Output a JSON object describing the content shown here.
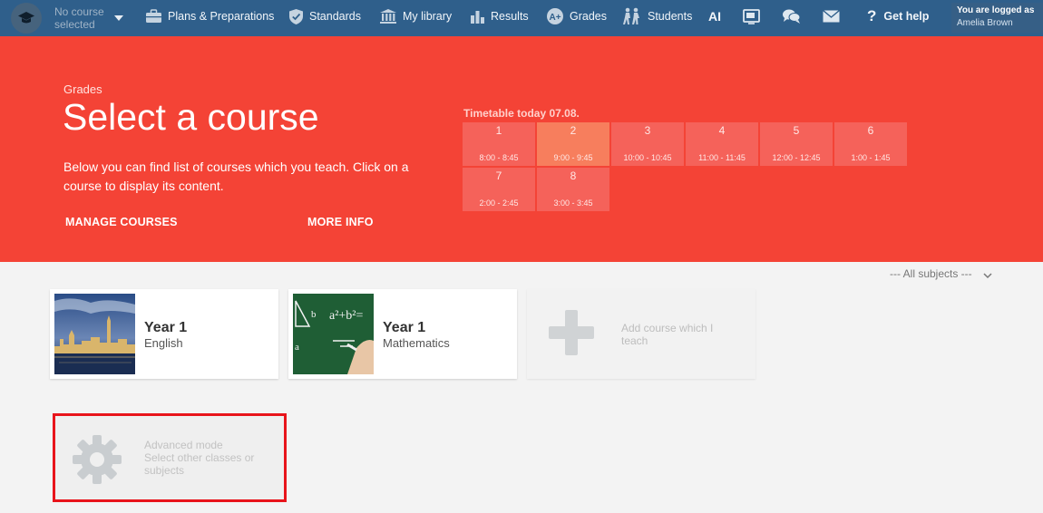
{
  "nav": {
    "course_selector": "No course selected",
    "items": [
      {
        "label": "Plans & Preparations",
        "icon": "briefcase-icon"
      },
      {
        "label": "Standards",
        "icon": "shield-check-icon"
      },
      {
        "label": "My library",
        "icon": "library-icon"
      },
      {
        "label": "Results",
        "icon": "bar-chart-icon"
      },
      {
        "label": "Grades",
        "icon": "grades-icon"
      },
      {
        "label": "Students",
        "icon": "students-icon"
      }
    ],
    "ai_label": "AI",
    "help_label": "Get help",
    "login": {
      "line1": "You are logged as",
      "user": "Amelia Brown"
    }
  },
  "hero": {
    "breadcrumb": "Grades",
    "title": "Select a course",
    "description": "Below you can find list of courses which you teach. Click on a course to display its content.",
    "manage_courses": "MANAGE COURSES",
    "more_info": "MORE INFO",
    "accent_color": "#f44336"
  },
  "timetable": {
    "title": "Timetable today 07.08.",
    "periods": [
      {
        "num": "1",
        "time": "8:00 - 8:45",
        "active": false
      },
      {
        "num": "2",
        "time": "9:00 - 9:45",
        "active": true
      },
      {
        "num": "3",
        "time": "10:00 - 10:45",
        "active": false
      },
      {
        "num": "4",
        "time": "11:00 - 11:45",
        "active": false
      },
      {
        "num": "5",
        "time": "12:00 - 12:45",
        "active": false
      },
      {
        "num": "6",
        "time": "1:00 - 1:45",
        "active": false
      },
      {
        "num": "7",
        "time": "2:00 - 2:45",
        "active": false
      },
      {
        "num": "8",
        "time": "3:00 - 3:45",
        "active": false
      }
    ]
  },
  "filter": {
    "label": "--- All subjects ---"
  },
  "courses": [
    {
      "year": "Year 1",
      "subject": "English"
    },
    {
      "year": "Year 1",
      "subject": "Mathematics"
    }
  ],
  "add_course": {
    "label": "Add course which I teach"
  },
  "advanced": {
    "title": "Advanced mode",
    "subtitle": "Select other classes or subjects"
  }
}
